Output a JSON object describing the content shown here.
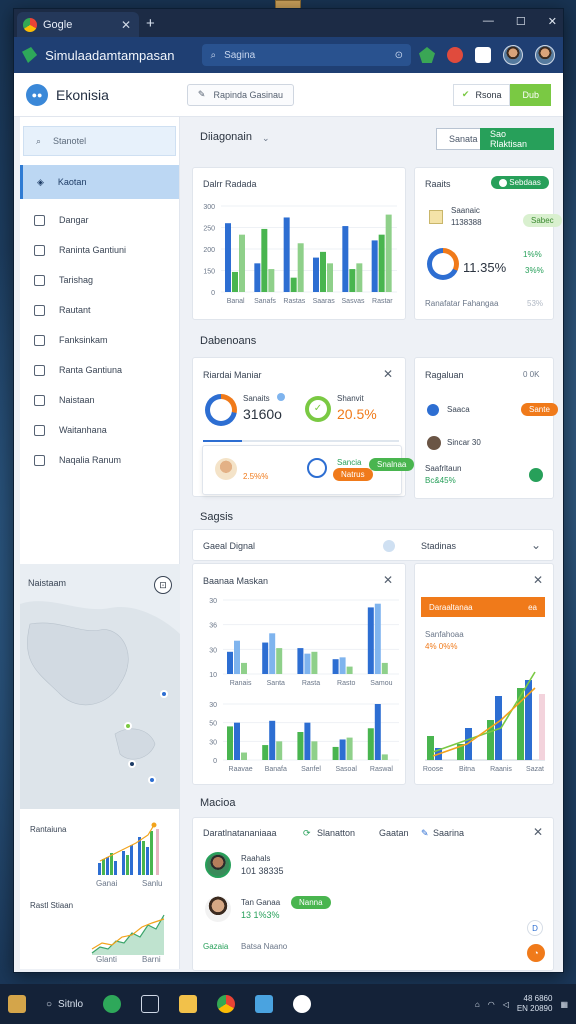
{
  "browser": {
    "tab_title": "Gogle",
    "app_name": "Simulaadamtampasan",
    "search_placeholder": "Sagina"
  },
  "header": {
    "brand": "Ekonisia",
    "crumb": "Rapinda Gasinau",
    "action1": "Rsona",
    "action2": "Dub"
  },
  "sidebar": {
    "search": "Stanotel",
    "active": "Kaotan",
    "items": [
      "Dangar",
      "Raninta Gantiuni",
      "Tarishag",
      "Rautant",
      "Fanksinkam",
      "Ranta Gantiuna",
      "Naistaan",
      "Waitanhana",
      "Naqalia Ranum"
    ],
    "map_title": "Naistaam",
    "chart1_title": "Rantaiuna",
    "chart2_title": "Rastl Stiaan",
    "chart1_labels": [
      "Ganai",
      "Sanlu"
    ],
    "chart2_labels": [
      "Glanti",
      "Barni"
    ]
  },
  "main": {
    "section1_title": "Diiagonain",
    "btn_outline": "Sanata",
    "btn_green": "Sao Rlaktisan",
    "card1_title": "Dalrr Radada",
    "card1_xlabels": [
      "Banal",
      "Sanafs",
      "Rastas",
      "Saaras",
      "Sasvas",
      "Rastar"
    ],
    "card1_yticks": [
      "300",
      "250",
      "200",
      "150",
      "0"
    ],
    "card2_title": "Raaits",
    "card2_pill": "Sebdaas",
    "card2_row1_name": "Saanaic",
    "card2_row1_value": "1138388",
    "card2_row1_tag": "Sabec",
    "card2_pct": "11.35%",
    "card2_legend1": "1%%",
    "card2_legend2": "3%%",
    "card2_footer": "Ranafatar Fahangaa",
    "card2_footer_right": "53%",
    "section2_title": "Dabenoans",
    "card3_title": "Riardai Maniar",
    "card3_label1": "Sanaits",
    "card3_value1": "3160o",
    "card3_label2": "Shanvit",
    "card3_value2": "20.5%",
    "card3_row2_value": "2.5%%",
    "card3_row2_label": "Sancia",
    "card3_row2_tag": "Natrus",
    "card3_row2_pill": "Snalnaa",
    "card4_title": "Ragaluan",
    "card4_corner": "0 0K",
    "card4_row1": "Saaca",
    "card4_row1_tag": "Sante",
    "card4_row2": "Sincar 30",
    "card4_row3": "Saafrltaun",
    "card4_row3_value": "Bc&45%",
    "section3_title": "Sagsis",
    "bar_title": "Gaeal Dignal",
    "bar_right": "Stadinas",
    "card5_title": "Baanaa Maskan",
    "card5_yticks1": [
      "30",
      "36",
      "30",
      "10"
    ],
    "card5_xlabels1": [
      "Ranais",
      "Santa",
      "Rasta",
      "Rasto",
      "Samou"
    ],
    "card5_yticks2": [
      "30",
      "50",
      "30",
      "0"
    ],
    "card5_xlabels2": [
      "Raavae",
      "Banafa",
      "Sanfel",
      "Sasoal",
      "Raswal"
    ],
    "card6_banner": "Daraaltanaa",
    "card6_banner_right": "ea",
    "card6_sub": "Sanfahoaa",
    "card6_sub2": "4% 0%%",
    "card6_xlabels": [
      "Roose",
      "Bitna",
      "Raanis",
      "Sazat"
    ],
    "section4_title": "Macioa",
    "list_col1": "Daratlnatananiaaa",
    "list_col2": "Slanatton",
    "list_col3": "Gaatan",
    "list_col4": "Saarina",
    "person1_name": "Raahals",
    "person1_value": "101 38335",
    "person2_name": "Tan Ganaa",
    "person2_value": "13 1%3%",
    "person2_pill": "Nanna",
    "footer_col1": "Gazaia",
    "footer_col2": "Batsa Naano"
  },
  "chart_data": [
    {
      "type": "bar",
      "title": "Dalrr Radada",
      "categories": [
        "Banal",
        "Sanafs",
        "Rastas",
        "Saaras",
        "Sasvas",
        "Rastar"
      ],
      "series": [
        {
          "values": [
            240,
            100,
            260,
            120,
            230,
            180
          ]
        },
        {
          "values": [
            70,
            220,
            50,
            140,
            80,
            200
          ]
        },
        {
          "values": [
            200,
            80,
            170,
            100,
            100,
            270
          ]
        }
      ],
      "ylim": [
        0,
        300
      ]
    },
    {
      "type": "bar",
      "title": "Baanaa Maskan",
      "categories": [
        "Ranais",
        "Santa",
        "Rasta",
        "Rasto",
        "Samou"
      ],
      "series": [
        {
          "values": [
            12,
            17,
            14,
            8,
            36
          ]
        },
        {
          "values": [
            18,
            22,
            11,
            9,
            38
          ]
        },
        {
          "values": [
            6,
            14,
            12,
            4,
            6
          ]
        }
      ],
      "ylim": [
        0,
        40
      ]
    },
    {
      "type": "bar",
      "categories": [
        "Raavae",
        "Banafa",
        "Sanfel",
        "Sasoal",
        "Raswal"
      ],
      "series": [
        {
          "values": [
            18,
            8,
            15,
            7,
            17
          ]
        },
        {
          "values": [
            20,
            21,
            20,
            11,
            30
          ]
        },
        {
          "values": [
            4,
            10,
            10,
            12,
            3
          ]
        }
      ],
      "ylim": [
        0,
        30
      ]
    },
    {
      "type": "line",
      "categories": [
        "Roose",
        "Bitna",
        "Raanis",
        "Sazat"
      ],
      "series": [
        {
          "values": [
            2,
            5,
            8,
            22
          ]
        },
        {
          "values": [
            1,
            4,
            10,
            18
          ]
        }
      ]
    }
  ],
  "colors": {
    "blue": "#2d6ed2",
    "light_blue": "#7fb4ee",
    "green": "#49b54f",
    "orange": "#f07a1a",
    "brand_green": "#27a05a"
  }
}
